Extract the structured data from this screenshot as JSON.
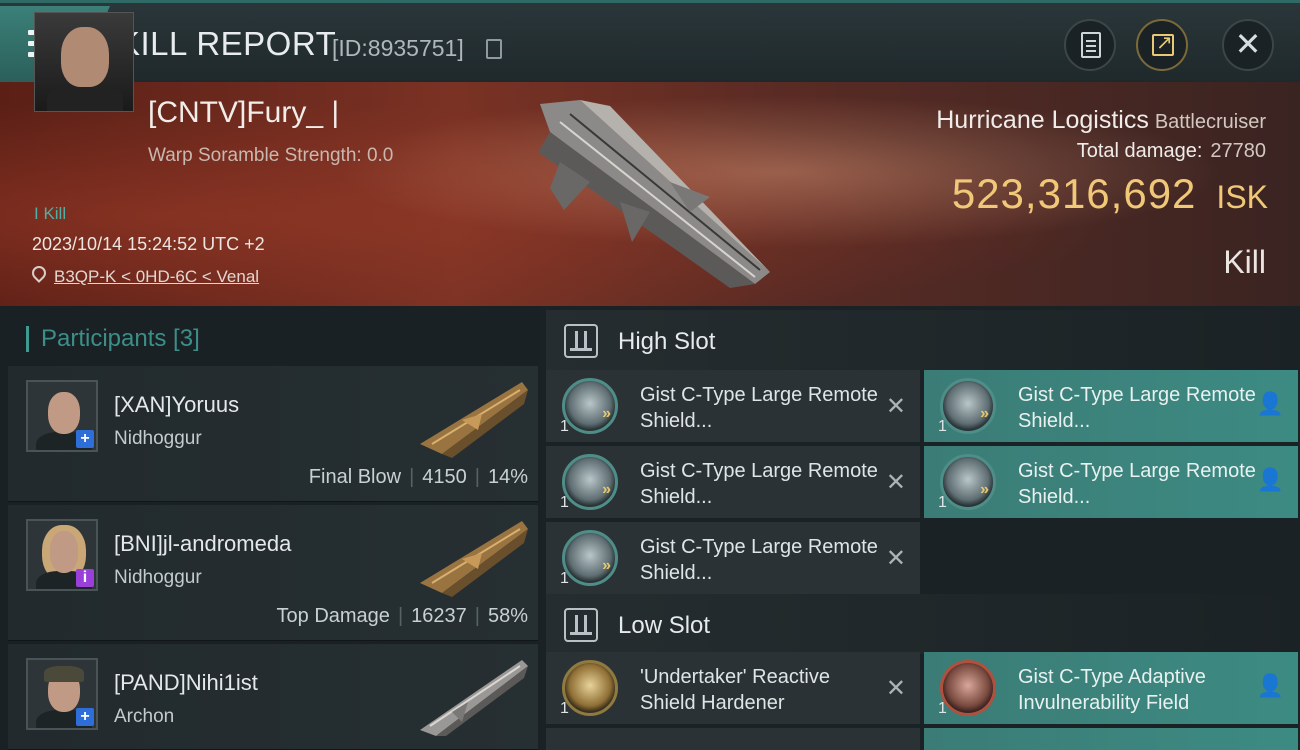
{
  "header": {
    "title": "KILL REPORT",
    "id_label": "[ID:8935751]"
  },
  "victim": {
    "name": "[CNTV]Fury_ |",
    "scramble": "Warp Soramble Strength: 0.0",
    "kill_tag": "I Kill",
    "datetime": "2023/10/14 15:24:52 UTC +2",
    "location": "B3QP-K < 0HD-6C < Venal",
    "ship": "Hurricane Logistics",
    "ship_class": "Battlecruiser",
    "total_damage_label": "Total damage:",
    "total_damage": "27780",
    "isk_value": "523,316,692",
    "isk_unit": "ISK",
    "result": "Kill"
  },
  "participants": {
    "title": "Participants [3]",
    "items": [
      {
        "name": "[XAN]Yoruus",
        "ship": "Nidhoggur",
        "tag": "Final Blow",
        "damage": "4150",
        "percent": "14%",
        "badge": "+"
      },
      {
        "name": "[BNI]jl-andromeda",
        "ship": "Nidhoggur",
        "tag": "Top Damage",
        "damage": "16237",
        "percent": "58%",
        "badge": "i"
      },
      {
        "name": "[PAND]Nihi1ist",
        "ship": "Archon",
        "badge": "+"
      }
    ]
  },
  "slots": {
    "high": {
      "title": "High Slot",
      "modules": [
        {
          "qty": "1",
          "name": "Gist C-Type Large Remote Shield...",
          "status": "✕"
        },
        {
          "qty": "1",
          "name": "Gist C-Type Large Remote Shield...",
          "status": "person"
        },
        {
          "qty": "1",
          "name": "Gist C-Type Large Remote Shield...",
          "status": "✕"
        },
        {
          "qty": "1",
          "name": "Gist C-Type Large Remote Shield...",
          "status": "person"
        },
        {
          "qty": "1",
          "name": "Gist C-Type Large Remote Shield...",
          "status": "✕"
        }
      ]
    },
    "low": {
      "title": "Low Slot",
      "modules": [
        {
          "qty": "1",
          "name": "'Undertaker' Reactive Shield Hardener",
          "status": "✕"
        },
        {
          "qty": "1",
          "name": "Gist C-Type Adaptive Invulnerability Field",
          "status": "person"
        }
      ]
    }
  },
  "colors": {
    "accent": "#3c8b83",
    "isk": "#f0c878",
    "banner": "#7a3224"
  },
  "icons": [
    "menu-icon",
    "copy-icon",
    "clipboard-icon",
    "share-icon",
    "close-icon",
    "location-pin-icon",
    "slot-icon",
    "remove-icon",
    "person-icon"
  ]
}
